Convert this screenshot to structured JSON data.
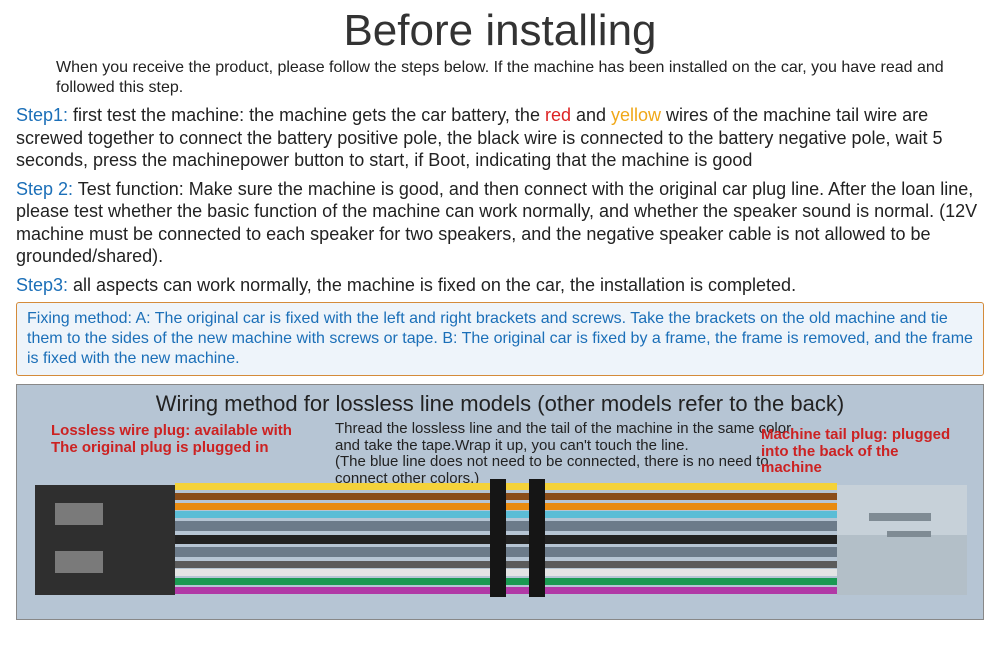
{
  "title": "Before installing",
  "intro": "When you receive the product, please follow the steps below. If the machine has been installed on the car, you have read and followed this step.",
  "step1": {
    "label": "Step1:",
    "pre": " first test the machine: the machine gets the car battery, the ",
    "red": "red",
    "and": " and ",
    "yellow": "yellow",
    "post": " wires of the machine tail wire are screwed together to connect the battery positive pole, the black wire is connected to the battery negative pole, wait 5 seconds, press the machinepower button to start, if Boot, indicating that the machine is good"
  },
  "step2": {
    "label": "Step 2:",
    "text": " Test function: Make sure the machine is good, and then connect with the original car plug line. After the loan line, please test whether the basic function of the machine can work normally, and whether the speaker sound is normal. (12V machine must be connected to each speaker for two speakers, and the negative speaker cable is not allowed to be grounded/shared)."
  },
  "step3": {
    "label": "Step3:",
    "text": " all aspects can work normally, the machine is fixed on the car, the installation is completed."
  },
  "fixbox": "Fixing method: A: The original car is fixed with the left and right brackets and screws. Take the brackets on the old machine and tie them to the sides of the new machine with screws or tape. B: The original car is fixed by a frame, the frame is removed, and the frame is fixed with the new machine.",
  "wire": {
    "title": "Wiring method for lossless line models (other models refer to the back)",
    "left_label": "Lossless wire plug: available with\nThe original plug is plugged in",
    "mid_label_1": "Thread the lossless line and the tail of the machine in the same color, and take the tape.Wrap it up, you can't touch the line.",
    "mid_label_2": " (The blue line does not need to be connected, there is no need to connect other colors.)",
    "right_label": "Machine tail plug: plugged into the back of the machine",
    "colors": [
      "#f4d23a",
      "#8a4d19",
      "#e88b10",
      "#5bbdd6",
      "#6c7b8a",
      "#222222",
      "#6c7b8a",
      "#5b5b5b",
      "#e4e4e4",
      "#1a9a52",
      "#b139a6"
    ]
  }
}
